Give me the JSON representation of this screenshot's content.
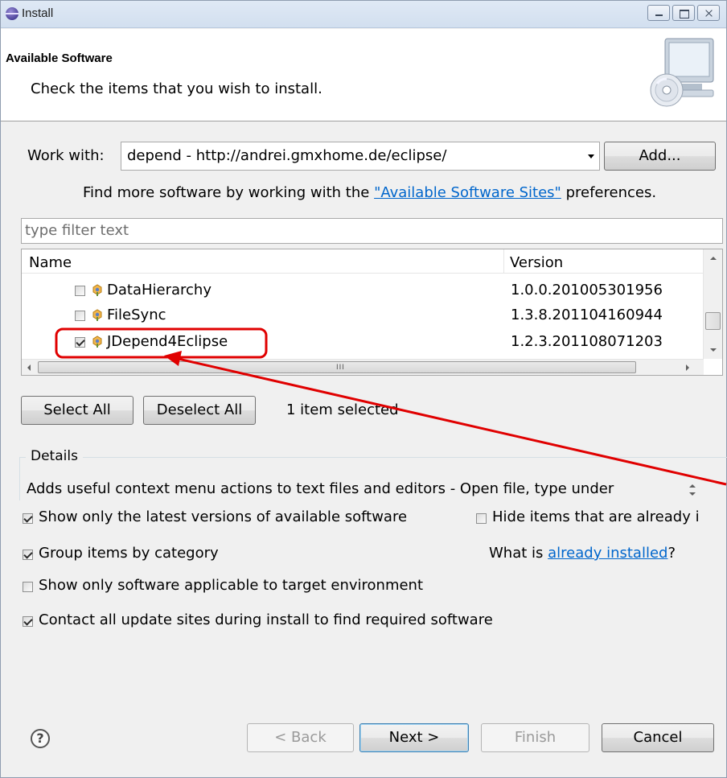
{
  "window": {
    "title": "Install"
  },
  "header": {
    "title": "Available Software",
    "description": "Check the items that you wish to install."
  },
  "work_with": {
    "label": "Work with:",
    "value": "depend - http://andrei.gmxhome.de/eclipse/",
    "add_button": "Add...",
    "hint_prefix": "Find more software by working with the",
    "hint_link": "\"Available Software Sites\"",
    "hint_suffix": "preferences."
  },
  "filter": {
    "placeholder": "type filter text"
  },
  "table": {
    "columns": [
      "Name",
      "Version"
    ],
    "rows": [
      {
        "name": "DataHierarchy",
        "version": "1.0.0.201005301956",
        "checked": false
      },
      {
        "name": "FileSync",
        "version": "1.3.8.201104160944",
        "checked": false
      },
      {
        "name": "JDepend4Eclipse",
        "version": "1.2.3.201108071203",
        "checked": true
      }
    ],
    "h_scroll_grip": "III"
  },
  "selection": {
    "select_all": "Select All",
    "deselect_all": "Deselect All",
    "status": "1 item selected"
  },
  "details": {
    "legend": "Details",
    "text": "Adds useful context menu actions to text files and editors - Open file, type under"
  },
  "options": {
    "latest_versions": {
      "label": "Show only the latest versions of available software",
      "checked": true
    },
    "hide_installed": {
      "label": "Hide items that are already i",
      "checked": false
    },
    "group_by_category": {
      "label": "Group items by category",
      "checked": true
    },
    "what_is_prefix": "What is",
    "what_is_link": "already installed",
    "what_is_suffix": "?",
    "target_env": {
      "label": "Show only software applicable to target environment",
      "checked": false
    },
    "contact_sites": {
      "label": "Contact all update sites during install to find required software",
      "checked": true
    }
  },
  "footer": {
    "help_glyph": "?",
    "back": "< Back",
    "next": "Next >",
    "finish": "Finish",
    "cancel": "Cancel"
  },
  "colors": {
    "annotation": "#e00000",
    "link": "#0066cc"
  }
}
